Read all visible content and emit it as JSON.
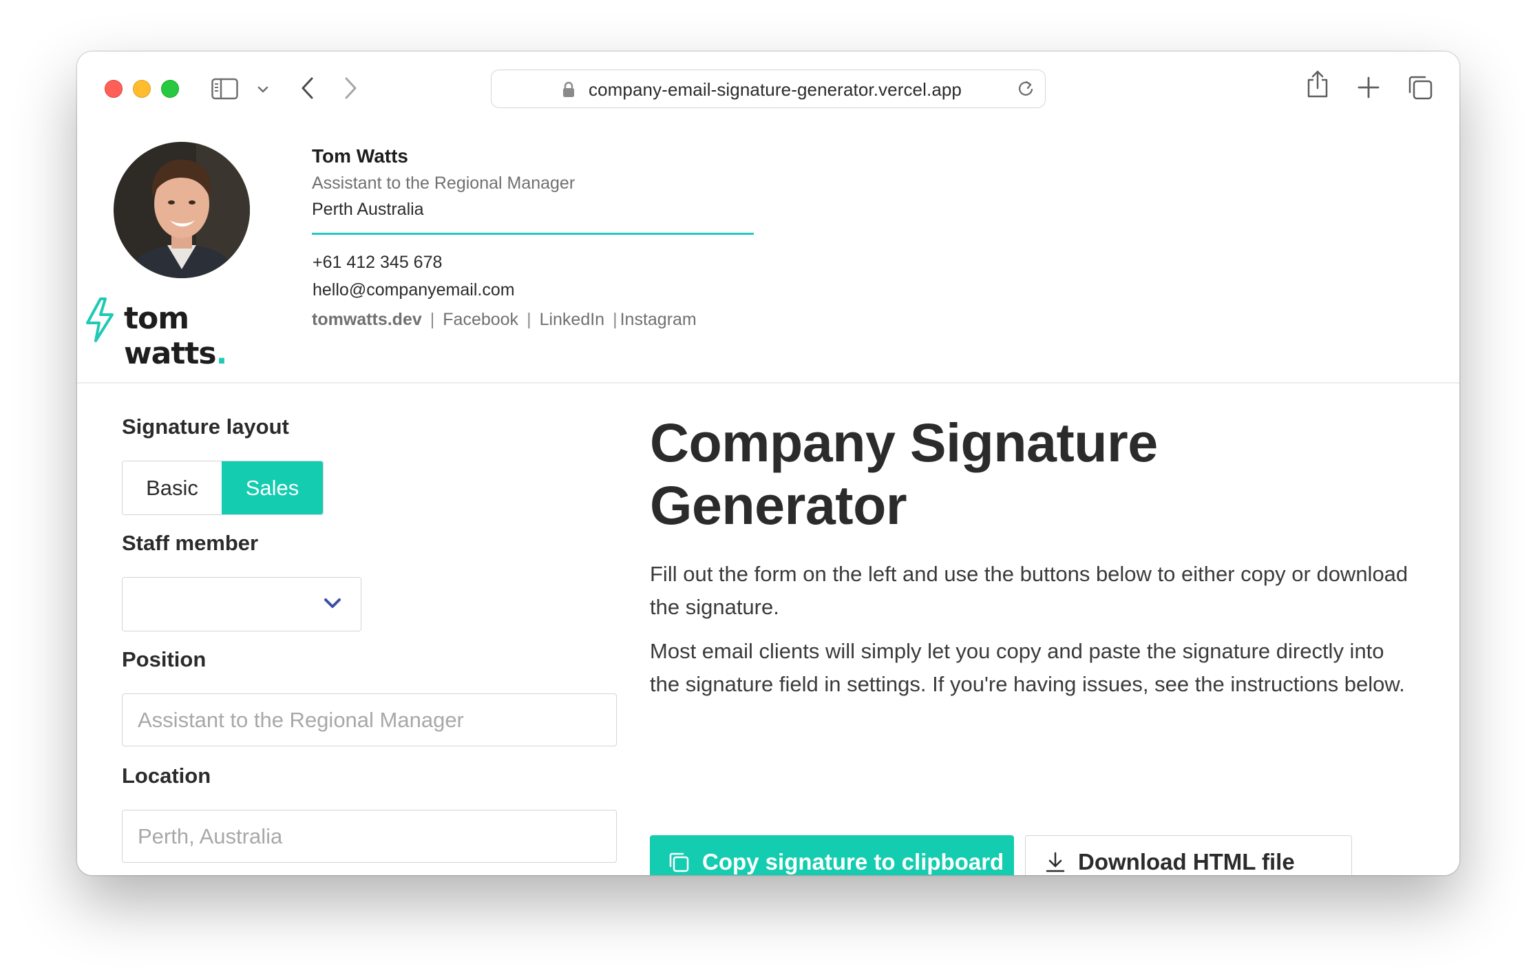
{
  "browser": {
    "url": "company-email-signature-generator.vercel.app",
    "icons": [
      "sidebar-icon",
      "chevron-down-icon",
      "back-icon",
      "forward-icon",
      "lock-icon",
      "reload-icon",
      "share-icon",
      "plus-icon",
      "tabs-icon"
    ]
  },
  "signature": {
    "name": "Tom Watts",
    "position": "Assistant to the Regional Manager",
    "location": "Perth Australia",
    "phone": "+61 412 345 678",
    "email": "hello@companyemail.com",
    "links": {
      "website": "tomwatts.dev",
      "sep1": "|",
      "facebook": "Facebook",
      "sep2": "|",
      "linkedin": "LinkedIn",
      "sep3": "|",
      "instagram": "Instagram"
    },
    "brand": {
      "text": "tom watts",
      "dot": "."
    },
    "accent_color": "#21c9c2"
  },
  "form": {
    "layout_label": "Signature layout",
    "layout_options": {
      "basic": "Basic",
      "sales": "Sales"
    },
    "layout_selected": "Sales",
    "staff_label": "Staff member",
    "staff_value": "",
    "position_label": "Position",
    "position_placeholder": "Assistant to the Regional Manager",
    "location_label": "Location",
    "location_placeholder": "Perth, Australia"
  },
  "main": {
    "title": "Company Signature Generator",
    "paragraph1": "Fill out the form on the left and use the buttons below to either copy or download the signature.",
    "paragraph2": "Most email clients will simply let you copy and paste the signature directly into the signature field in settings. If you're having issues, see the instructions below.",
    "copy_button": "Copy signature to clipboard",
    "download_button": "Download HTML file"
  },
  "colors": {
    "primary": "#14ccb0",
    "text": "#2b2b2b",
    "muted": "#707070",
    "select_chevron": "#3a4fa8"
  }
}
